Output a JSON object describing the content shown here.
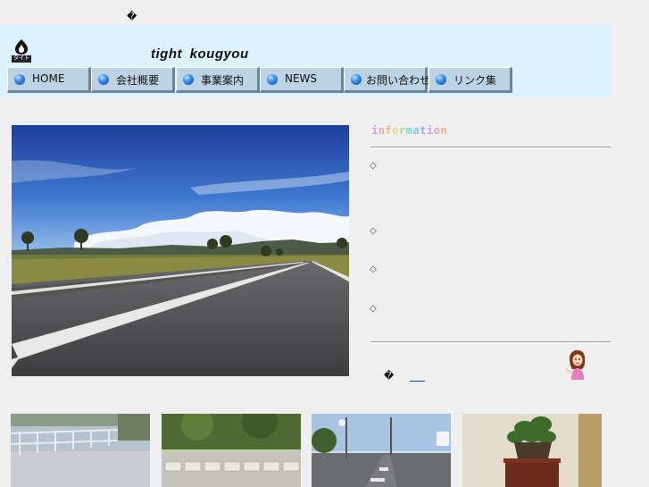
{
  "page": {
    "top_glyph": "�",
    "brand_title": "tight  kougyou"
  },
  "logo": {
    "caption": "タイト"
  },
  "nav": {
    "items": [
      {
        "label": "HOME"
      },
      {
        "label": "会社概要"
      },
      {
        "label": "事業案内"
      },
      {
        "label": "NEWS"
      },
      {
        "label": "お問い合わせ"
      },
      {
        "label": "リンク集"
      }
    ]
  },
  "info": {
    "title_letters": [
      "i",
      "n",
      "f",
      "o",
      "r",
      "m",
      "a",
      "t",
      "i",
      "o",
      "n"
    ],
    "bullets": [
      "◇",
      "◇",
      "◇",
      "◇"
    ],
    "footer_glyph": "�"
  },
  "colors": {
    "page_bg": "#efefef",
    "header_bg": "#dcf2fe",
    "nav_button_bg": "#bcd3e4",
    "link": "#1a3fcf"
  },
  "images": {
    "hero": "highway-landscape",
    "mascot": "woman-pointing",
    "thumbnails": [
      "rooftop-railing",
      "stone-retaining-wall",
      "road-junction",
      "potted-plant"
    ]
  }
}
